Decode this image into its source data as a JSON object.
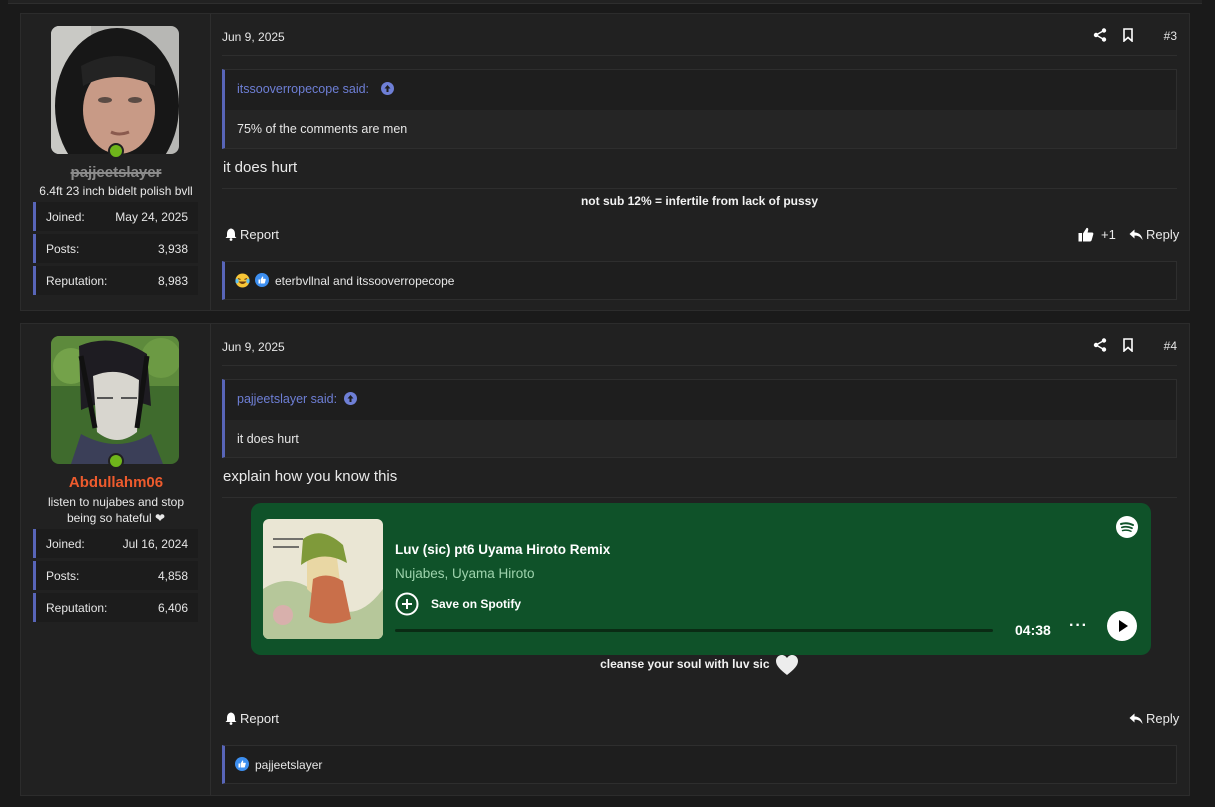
{
  "posts": [
    {
      "author": {
        "username": "pajjeetslayer",
        "user_title": "6.4ft 23 inch bidelt polish bvll",
        "stats": [
          {
            "label": "Joined:",
            "value": "May 24, 2025"
          },
          {
            "label": "Posts:",
            "value": "3,938"
          },
          {
            "label": "Reputation:",
            "value": "8,983"
          }
        ]
      },
      "date": "Jun 9, 2025",
      "number": "#3",
      "quote": {
        "header": "itssooverropecope said:",
        "text": "75% of the comments are men"
      },
      "message": "it does hurt",
      "signature": "not sub 12% = infertile from lack of pussy",
      "report_label": "Report",
      "like_count": "+1",
      "reply_label": "Reply",
      "reactions_text": "eterbvllnal and itssooverropecope"
    },
    {
      "author": {
        "username": "Abdullahm06",
        "user_title_line1": "listen to nujabes and stop",
        "user_title_line2": "being so hateful ❤",
        "stats": [
          {
            "label": "Joined:",
            "value": "Jul 16, 2024"
          },
          {
            "label": "Posts:",
            "value": "4,858"
          },
          {
            "label": "Reputation:",
            "value": "6,406"
          }
        ]
      },
      "date": "Jun 9, 2025",
      "number": "#4",
      "quote": {
        "header": "pajjeetslayer said:",
        "text": "it does hurt"
      },
      "message": "explain how you know this",
      "spotify": {
        "title": "Luv (sic) pt6 Uyama Hiroto Remix",
        "artists": "Nujabes, Uyama Hiroto",
        "save_label": "Save on Spotify",
        "duration": "04:38",
        "more_label": "···"
      },
      "caption": "cleanse your soul with luv sic",
      "report_label": "Report",
      "reply_label": "Reply",
      "reactions_text": "pajjeetslayer"
    }
  ],
  "colors": {
    "accent": "#5865b8",
    "link": "#6e7fd6",
    "online": "#6fb51b",
    "spotify_bg": "#0f5229",
    "username_orange": "#ee5b2d"
  }
}
